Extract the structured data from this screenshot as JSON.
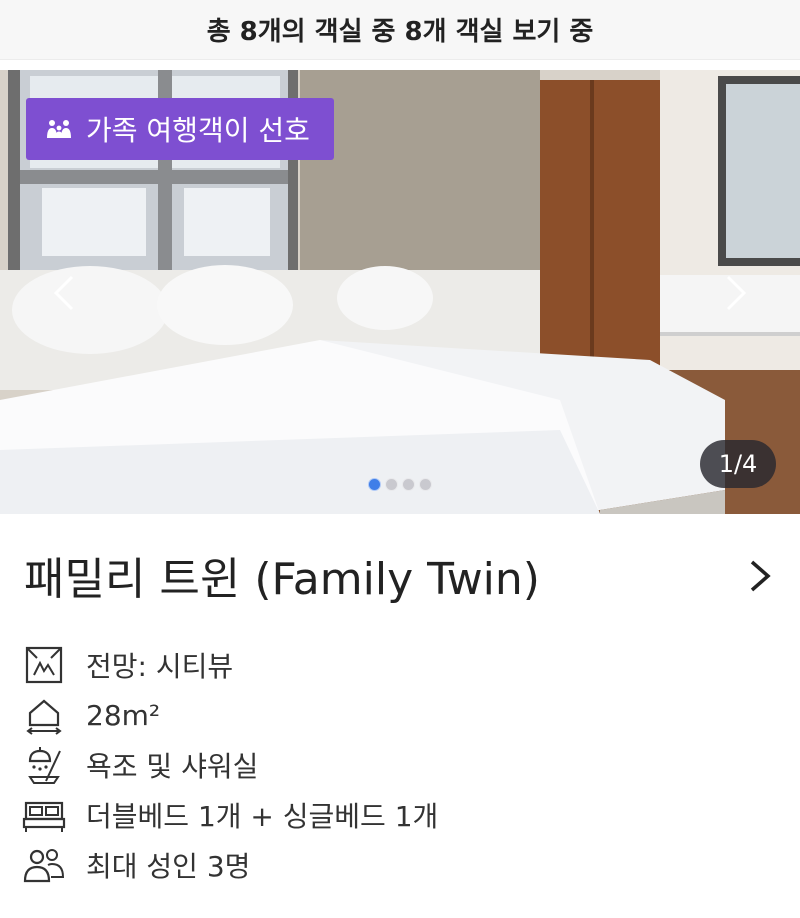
{
  "banner": {
    "text": "총 8개의 객실 중 8개 객실 보기 중"
  },
  "gallery": {
    "badge_label": "가족 여행객이 선호",
    "badge_icon": "family-icon",
    "counter": "1/4",
    "current_index": 1,
    "total_images": 4,
    "prev_icon": "chevron-left-icon",
    "next_icon": "chevron-right-icon",
    "badge_color": "#7e4fd1",
    "active_dot_color": "#3f7ee8"
  },
  "room": {
    "title": "패밀리 트윈 (Family Twin)",
    "chevron_icon": "chevron-right-icon"
  },
  "features": [
    {
      "icon": "window-view-icon",
      "text": "전망: 시티뷰"
    },
    {
      "icon": "house-size-icon",
      "text": "28m²"
    },
    {
      "icon": "shower-icon",
      "text": "욕조 및 샤워실"
    },
    {
      "icon": "bed-icon",
      "text": "더블베드 1개 + 싱글베드 1개"
    },
    {
      "icon": "people-icon",
      "text": "최대 성인 3명"
    }
  ]
}
